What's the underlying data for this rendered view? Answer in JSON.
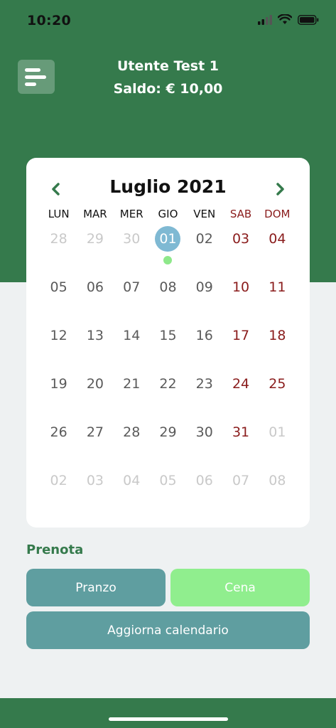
{
  "status_bar": {
    "time": "10:20"
  },
  "header": {
    "username": "Utente Test 1",
    "balance": "Saldo: € 10,00"
  },
  "calendar": {
    "title": "Luglio 2021",
    "weekdays": [
      "LUN",
      "MAR",
      "MER",
      "GIO",
      "VEN",
      "SAB",
      "DOM"
    ],
    "weeks": [
      [
        {
          "label": "28",
          "outside": true
        },
        {
          "label": "29",
          "outside": true
        },
        {
          "label": "30",
          "outside": true
        },
        {
          "label": "01",
          "selected": true,
          "dot": true
        },
        {
          "label": "02"
        },
        {
          "label": "03",
          "weekend": true
        },
        {
          "label": "04",
          "weekend": true
        }
      ],
      [
        {
          "label": "05"
        },
        {
          "label": "06"
        },
        {
          "label": "07"
        },
        {
          "label": "08"
        },
        {
          "label": "09"
        },
        {
          "label": "10",
          "weekend": true
        },
        {
          "label": "11",
          "weekend": true
        }
      ],
      [
        {
          "label": "12"
        },
        {
          "label": "13"
        },
        {
          "label": "14"
        },
        {
          "label": "15"
        },
        {
          "label": "16"
        },
        {
          "label": "17",
          "weekend": true
        },
        {
          "label": "18",
          "weekend": true
        }
      ],
      [
        {
          "label": "19"
        },
        {
          "label": "20"
        },
        {
          "label": "21"
        },
        {
          "label": "22"
        },
        {
          "label": "23"
        },
        {
          "label": "24",
          "weekend": true
        },
        {
          "label": "25",
          "weekend": true
        }
      ],
      [
        {
          "label": "26"
        },
        {
          "label": "27"
        },
        {
          "label": "28"
        },
        {
          "label": "29"
        },
        {
          "label": "30"
        },
        {
          "label": "31",
          "weekend": true
        },
        {
          "label": "01",
          "outside": true
        }
      ],
      [
        {
          "label": "02",
          "outside": true
        },
        {
          "label": "03",
          "outside": true
        },
        {
          "label": "04",
          "outside": true
        },
        {
          "label": "05",
          "outside": true
        },
        {
          "label": "06",
          "outside": true
        },
        {
          "label": "07",
          "outside": true
        },
        {
          "label": "08",
          "outside": true
        }
      ]
    ]
  },
  "booking": {
    "label": "Prenota",
    "lunch_label": "Pranzo",
    "dinner_label": "Cena",
    "update_label": "Aggiorna calendario"
  },
  "colors": {
    "primary_green": "#357a4c",
    "teal": "#5f9ea0",
    "light_green": "#90ee8e",
    "weekend_red": "#8a1c1c",
    "selected_blue": "#7fb9d3"
  },
  "icons": [
    "signal-icon",
    "wifi-icon",
    "battery-icon",
    "menu-icon",
    "chevron-left-icon",
    "chevron-right-icon"
  ]
}
